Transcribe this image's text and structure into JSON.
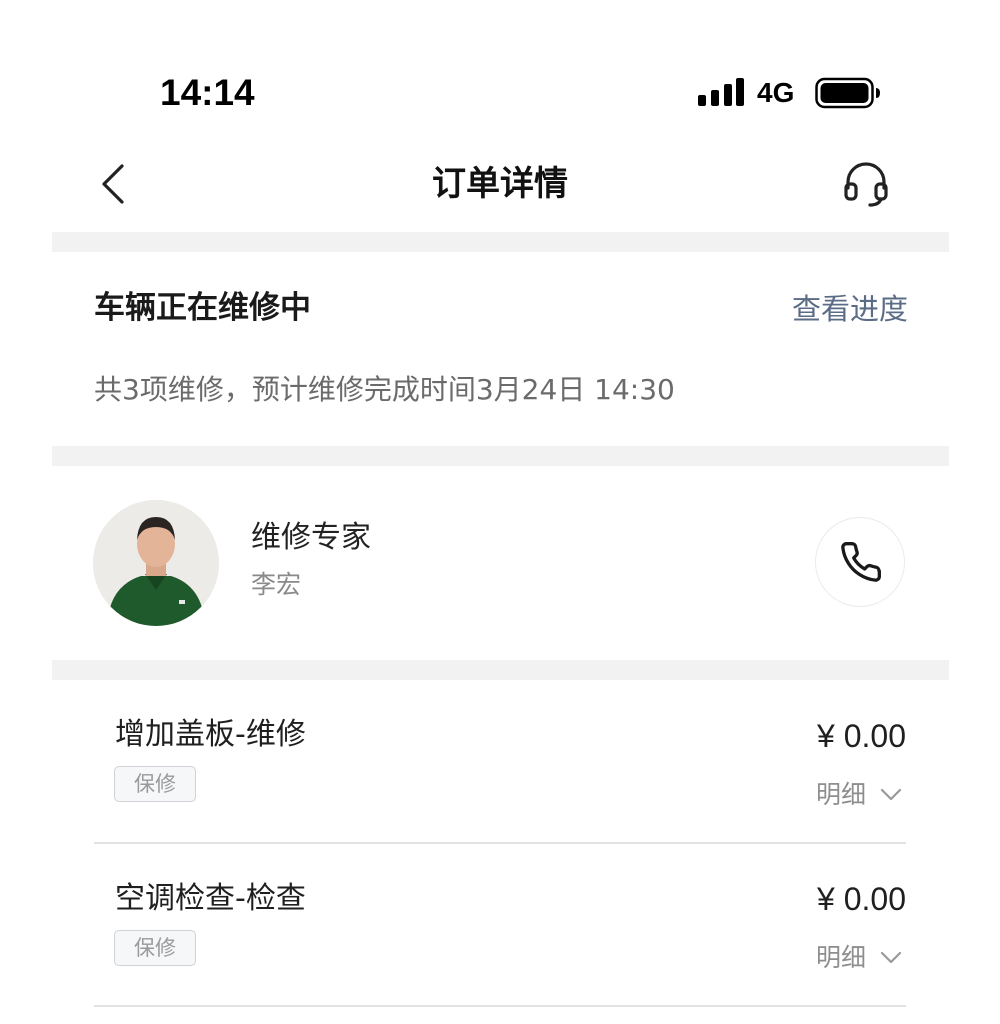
{
  "status_bar": {
    "time": "14:14",
    "network": "4G",
    "signal_icon": "signal-bars-icon",
    "battery_icon": "battery-full-icon"
  },
  "nav": {
    "title": "订单详情",
    "back_icon": "chevron-left-icon",
    "support_icon": "headset-icon"
  },
  "repair_status": {
    "title": "车辆正在维修中",
    "progress_link": "查看进度",
    "description": "共3项维修，预计维修完成时间3月24日 14:30"
  },
  "expert": {
    "role": "维修专家",
    "name": "李宏",
    "call_icon": "phone-icon"
  },
  "items": [
    {
      "name": "增加盖板-维修",
      "tag": "保修",
      "price": "¥ 0.00",
      "detail_label": "明细"
    },
    {
      "name": "空调检查-检查",
      "tag": "保修",
      "price": "¥ 0.00",
      "detail_label": "明细"
    }
  ],
  "colors": {
    "link": "#5b6c86",
    "separator": "#f2f2f2",
    "secondary_text": "#8a8a8a",
    "shirt_green": "#1f5a2c"
  }
}
